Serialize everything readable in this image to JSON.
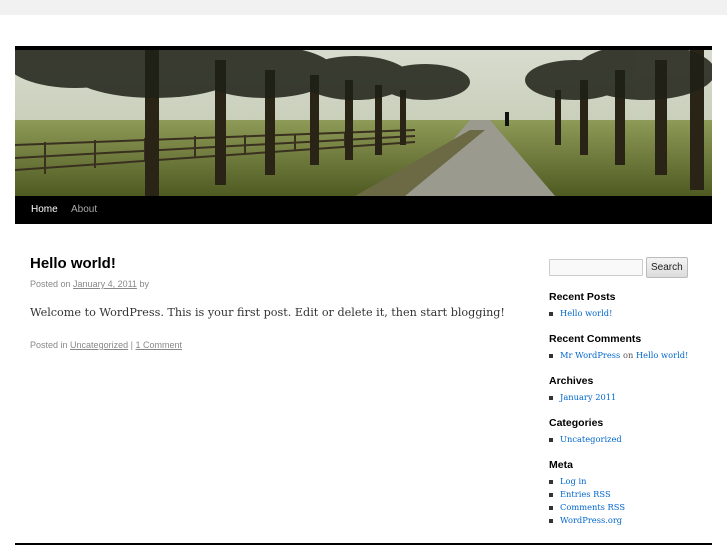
{
  "header": {
    "image_icon": "header-photo"
  },
  "nav": {
    "items": [
      {
        "label": "Home",
        "current": true
      },
      {
        "label": "About",
        "current": false
      }
    ]
  },
  "post": {
    "title": "Hello world!",
    "meta_prefix": "Posted on",
    "date": "January 4, 2011",
    "meta_by": "by",
    "body": "Welcome to WordPress. This is your first post. Edit or delete it, then start blogging!",
    "utility_prefix": "Posted in",
    "category": "Uncategorized",
    "separator": "|",
    "comments": "1 Comment"
  },
  "sidebar": {
    "search": {
      "placeholder": "",
      "button_label": "Search"
    },
    "recent_posts": {
      "title": "Recent Posts",
      "items": [
        "Hello world!"
      ]
    },
    "recent_comments": {
      "title": "Recent Comments",
      "author": "Mr WordPress",
      "on": "on",
      "post": "Hello world!"
    },
    "archives": {
      "title": "Archives",
      "items": [
        "January 2011"
      ]
    },
    "categories": {
      "title": "Categories",
      "items": [
        "Uncategorized"
      ]
    },
    "meta": {
      "title": "Meta",
      "items": [
        "Log in",
        "Entries RSS",
        "Comments RSS",
        "WordPress.org"
      ]
    }
  },
  "colors": {
    "link": "#0066cc",
    "nav_bg": "#000000",
    "page_bg": "#ffffff",
    "outer_bg": "#f1f1f1"
  }
}
